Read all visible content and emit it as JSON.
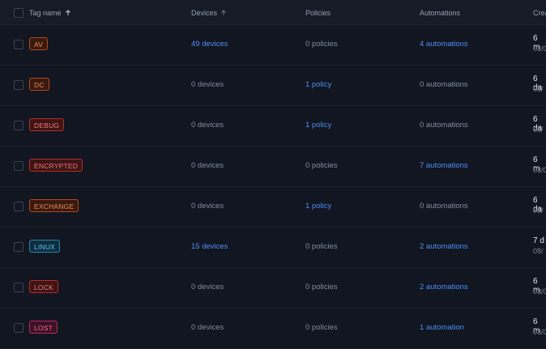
{
  "header": {
    "tag_name": "Tag name",
    "devices": "Devices",
    "policies": "Policies",
    "automations": "Automations",
    "created": "Crea"
  },
  "colors": {
    "orange_bg": "#3a1a0f",
    "orange_border": "#b1491f",
    "orange_text": "#f08a55",
    "red_bg": "#3e1414",
    "red_border": "#b52b2b",
    "red_text": "#f07a7a",
    "cyan_bg": "#0f2d3d",
    "cyan_border": "#2a86ad",
    "cyan_text": "#5cc6f0",
    "pink_bg": "#3d1024",
    "pink_border": "#b62a63",
    "pink_text": "#f06ba0",
    "link": "#4d8ef5"
  },
  "rows": [
    {
      "tag": "AV",
      "tone": "orange",
      "devices": "49 devices",
      "devices_link": true,
      "policies": "0 policies",
      "policies_link": false,
      "automations": "4 automations",
      "automations_link": true,
      "created_top": "6 m",
      "created_bottom": "03/0"
    },
    {
      "tag": "DC",
      "tone": "orange",
      "devices": "0 devices",
      "devices_link": false,
      "policies": "1 policy",
      "policies_link": true,
      "automations": "0 automations",
      "automations_link": false,
      "created_top": "6 da",
      "created_bottom": "08/"
    },
    {
      "tag": "DEBUG",
      "tone": "red",
      "devices": "0 devices",
      "devices_link": false,
      "policies": "1 policy",
      "policies_link": true,
      "automations": "0 automations",
      "automations_link": false,
      "created_top": "6 da",
      "created_bottom": "08/"
    },
    {
      "tag": "ENCRYPTED",
      "tone": "red",
      "devices": "0 devices",
      "devices_link": false,
      "policies": "0 policies",
      "policies_link": false,
      "automations": "7 automations",
      "automations_link": true,
      "created_top": "6 m",
      "created_bottom": "03/0"
    },
    {
      "tag": "EXCHANGE",
      "tone": "orange",
      "devices": "0 devices",
      "devices_link": false,
      "policies": "1 policy",
      "policies_link": true,
      "automations": "0 automations",
      "automations_link": false,
      "created_top": "6 da",
      "created_bottom": "08/"
    },
    {
      "tag": "LINUX",
      "tone": "cyan",
      "devices": "15 devices",
      "devices_link": true,
      "policies": "0 policies",
      "policies_link": false,
      "automations": "2 automations",
      "automations_link": true,
      "created_top": "7 d",
      "created_bottom": "08/"
    },
    {
      "tag": "LOCK",
      "tone": "red",
      "devices": "0 devices",
      "devices_link": false,
      "policies": "0 policies",
      "policies_link": false,
      "automations": "2 automations",
      "automations_link": true,
      "created_top": "6 m",
      "created_bottom": "03/0"
    },
    {
      "tag": "LOST",
      "tone": "pink",
      "devices": "0 devices",
      "devices_link": false,
      "policies": "0 policies",
      "policies_link": false,
      "automations": "1 automation",
      "automations_link": true,
      "created_top": "6 m",
      "created_bottom": "03/0"
    }
  ]
}
